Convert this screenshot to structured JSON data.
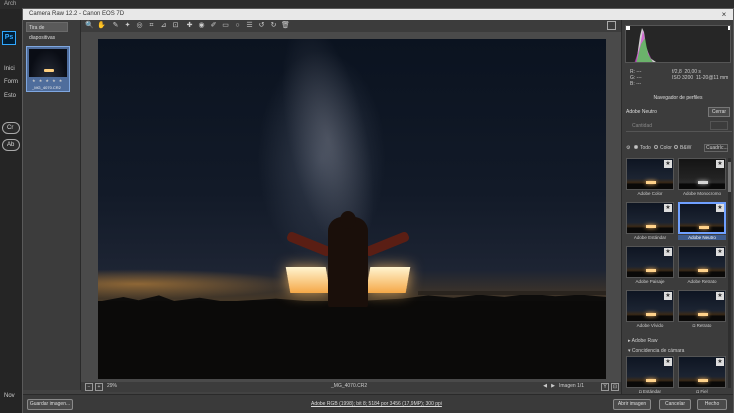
{
  "ps": {
    "menu_fragment": "Arch",
    "logo": "Ps",
    "side_labels": [
      "Inici",
      "Form",
      "Esto"
    ],
    "pills": [
      "Cr",
      "Ab"
    ],
    "bottom_label": "Nov"
  },
  "window": {
    "title": "Camera Raw 12.2  -  Canon EOS 7D",
    "close_glyph": "×"
  },
  "filmstrip": {
    "header": "Tira de diapositivas",
    "thumb_stars": "★ ★ ★ ★ ★",
    "thumb_name": "_MG_4070.CR2"
  },
  "toolbar": {
    "icons": [
      "zoom-icon",
      "hand-icon",
      "white-balance-icon",
      "color-sampler-icon",
      "targeted-adjust-icon",
      "crop-icon",
      "straighten-icon",
      "transform-icon",
      "spot-removal-icon",
      "red-eye-icon",
      "adjustment-brush-icon",
      "graduated-filter-icon",
      "radial-filter-icon",
      "preferences-icon",
      "rotate-left-icon",
      "rotate-right-icon",
      "trash-icon"
    ],
    "glyphs": [
      "🔍",
      "✋",
      "✎",
      "✦",
      "◎",
      "⌗",
      "⊿",
      "⊡",
      "✚",
      "◉",
      "✐",
      "▭",
      "○",
      "☰",
      "↺",
      "↻",
      "🗑"
    ]
  },
  "preview": {
    "zoom": "29%",
    "filename": "_MG_4070.CR2",
    "image_count": "Imagen 1/1"
  },
  "footer": {
    "save_label": "Guardar imagen...",
    "workflow": "Adobe RGB (1998); bit 8; 5184 por 3456 (17,9MP); 300 ppi",
    "open_label": "Abrir imagen",
    "cancel_label": "Cancelar",
    "done_label": "Hecho"
  },
  "info": {
    "r": "R:   ---",
    "g": "G:   ---",
    "b": "B:   ---",
    "aperture": "f/2,8",
    "shutter": "20,00 s",
    "iso": "ISO 3200",
    "focal": "11-20@11 mm"
  },
  "profile_panel": {
    "title": "Navegador de perfiles",
    "current": "Adobe Neutro",
    "close_label": "Cerrar",
    "amount_label": "Cantidad",
    "filters": [
      "Todo",
      "Color",
      "B&W"
    ],
    "filter_select": "Cuadríc...",
    "adobe_raw": "Adobe Raw",
    "camera_match": "Concidencia de cámara",
    "tiles": [
      {
        "label": "Adobe Color"
      },
      {
        "label": "Adobe Monocromo"
      },
      {
        "label": "Adobe Estándar"
      },
      {
        "label": "Adobe Neutro"
      },
      {
        "label": "Adobe Paisaje"
      },
      {
        "label": "Adobe Retrato"
      },
      {
        "label": "Adobe Vívido"
      },
      {
        "label": "◘ Retrato"
      },
      {
        "label": "◘ Estándar"
      },
      {
        "label": "◘ Fiel"
      }
    ],
    "star": "★"
  },
  "colors": {
    "accent": "#6fa0ff",
    "window_bg": "#424242"
  }
}
